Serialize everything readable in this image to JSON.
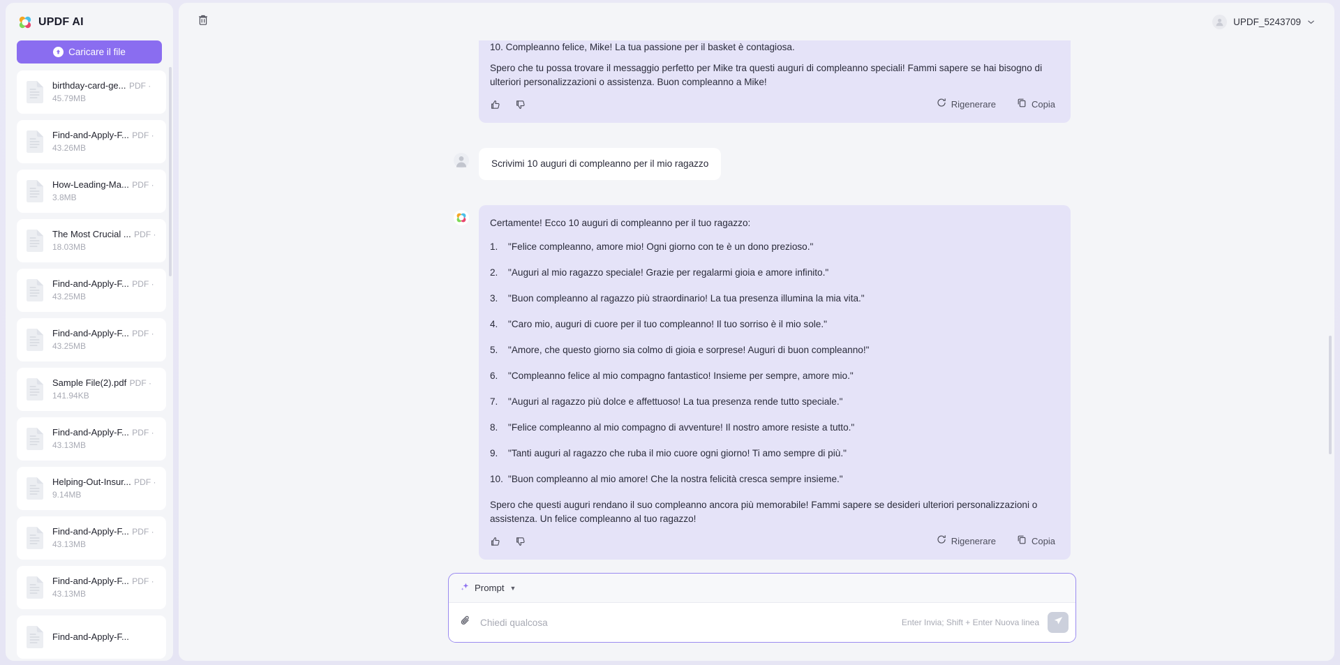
{
  "app": {
    "brand": "UPDF AI",
    "brand_logo_icon": "updf-flower-logo"
  },
  "sidebar": {
    "upload_label": "Caricare il file",
    "upload_icon": "upload-arrow-icon",
    "files": [
      {
        "name": "birthday-card-ge...",
        "meta": "PDF · 45.79MB"
      },
      {
        "name": "Find-and-Apply-F...",
        "meta": "PDF · 43.26MB"
      },
      {
        "name": "How-Leading-Ma...",
        "meta": "PDF · 3.8MB"
      },
      {
        "name": "The Most Crucial ...",
        "meta": "PDF · 18.03MB"
      },
      {
        "name": "Find-and-Apply-F...",
        "meta": "PDF · 43.25MB"
      },
      {
        "name": "Find-and-Apply-F...",
        "meta": "PDF · 43.25MB"
      },
      {
        "name": "Sample File(2).pdf",
        "meta": "PDF · 141.94KB"
      },
      {
        "name": "Find-and-Apply-F...",
        "meta": "PDF · 43.13MB"
      },
      {
        "name": "Helping-Out-Insur...",
        "meta": "PDF · 9.14MB"
      },
      {
        "name": "Find-and-Apply-F...",
        "meta": "PDF · 43.13MB"
      },
      {
        "name": "Find-and-Apply-F...",
        "meta": "PDF · 43.13MB"
      },
      {
        "name": "Find-and-Apply-F...",
        "meta": ""
      }
    ]
  },
  "topbar": {
    "trash_icon": "trash-icon",
    "user_name": "UPDF_5243709",
    "avatar_icon": "user-avatar-icon",
    "chevron_icon": "chevron-down-icon"
  },
  "chat": {
    "prev_response": {
      "clipped_line": "10. Compleanno felice, Mike! La tua passione per il basket è contagiosa.",
      "closing": "Spero che tu possa trovare il messaggio perfetto per Mike tra questi auguri di compleanno speciali! Fammi sapere se hai bisogno di ulteriori personalizzazioni o assistenza. Buon compleanno a Mike!",
      "regenerate_label": "Rigenerare",
      "copy_label": "Copia",
      "thumbs_up_icon": "thumbs-up-icon",
      "thumbs_down_icon": "thumbs-down-icon",
      "regenerate_icon": "refresh-icon",
      "copy_icon": "copy-icon"
    },
    "user_message": "Scrivimi 10 auguri di compleanno per il mio ragazzo",
    "ai_response": {
      "intro": "Certamente! Ecco 10 auguri di compleanno per il tuo ragazzo:",
      "items": [
        {
          "num": "1.",
          "text": "\"Felice compleanno, amore mio! Ogni giorno con te è un dono prezioso.\""
        },
        {
          "num": "2.",
          "text": "\"Auguri al mio ragazzo speciale! Grazie per regalarmi gioia e amore infinito.\""
        },
        {
          "num": "3.",
          "text": "\"Buon compleanno al ragazzo più straordinario! La tua presenza illumina la mia vita.\""
        },
        {
          "num": "4.",
          "text": "\"Caro mio, auguri di cuore per il tuo compleanno! Il tuo sorriso è il mio sole.\""
        },
        {
          "num": "5.",
          "text": "\"Amore, che questo giorno sia colmo di gioia e sorprese! Auguri di buon compleanno!\""
        },
        {
          "num": "6.",
          "text": "\"Compleanno felice al mio compagno fantastico! Insieme per sempre, amore mio.\""
        },
        {
          "num": "7.",
          "text": "\"Auguri al ragazzo più dolce e affettuoso! La tua presenza rende tutto speciale.\""
        },
        {
          "num": "8.",
          "text": "\"Felice compleanno al mio compagno di avventure! Il nostro amore resiste a tutto.\""
        },
        {
          "num": "9.",
          "text": "\"Tanti auguri al ragazzo che ruba il mio cuore ogni giorno! Ti amo sempre di più.\""
        },
        {
          "num": "10.",
          "text": "\"Buon compleanno al mio amore! Che la nostra felicità cresca sempre insieme.\""
        }
      ],
      "closing": "Spero che questi auguri rendano il suo compleanno ancora più memorabile! Fammi sapere se desideri ulteriori personalizzazioni o assistenza. Un felice compleanno al tuo ragazzo!",
      "regenerate_label": "Rigenerare",
      "copy_label": "Copia",
      "thumbs_up_icon": "thumbs-up-icon",
      "thumbs_down_icon": "thumbs-down-icon",
      "regenerate_icon": "refresh-icon",
      "copy_icon": "copy-icon"
    }
  },
  "composer": {
    "prompt_label": "Prompt",
    "sparkle_icon": "sparkle-icon",
    "caret_icon": "caret-down-icon",
    "attach_icon": "paperclip-icon",
    "input_value": "",
    "input_placeholder": "Chiedi qualcosa",
    "hint": "Enter Invia; Shift + Enter Nuova linea",
    "send_icon": "send-icon"
  },
  "colors": {
    "accent": "#8a6df0",
    "ai_bubble": "#e5e3f8",
    "page_bg": "#e8e7f5",
    "panel_bg": "#f4f5f8"
  }
}
